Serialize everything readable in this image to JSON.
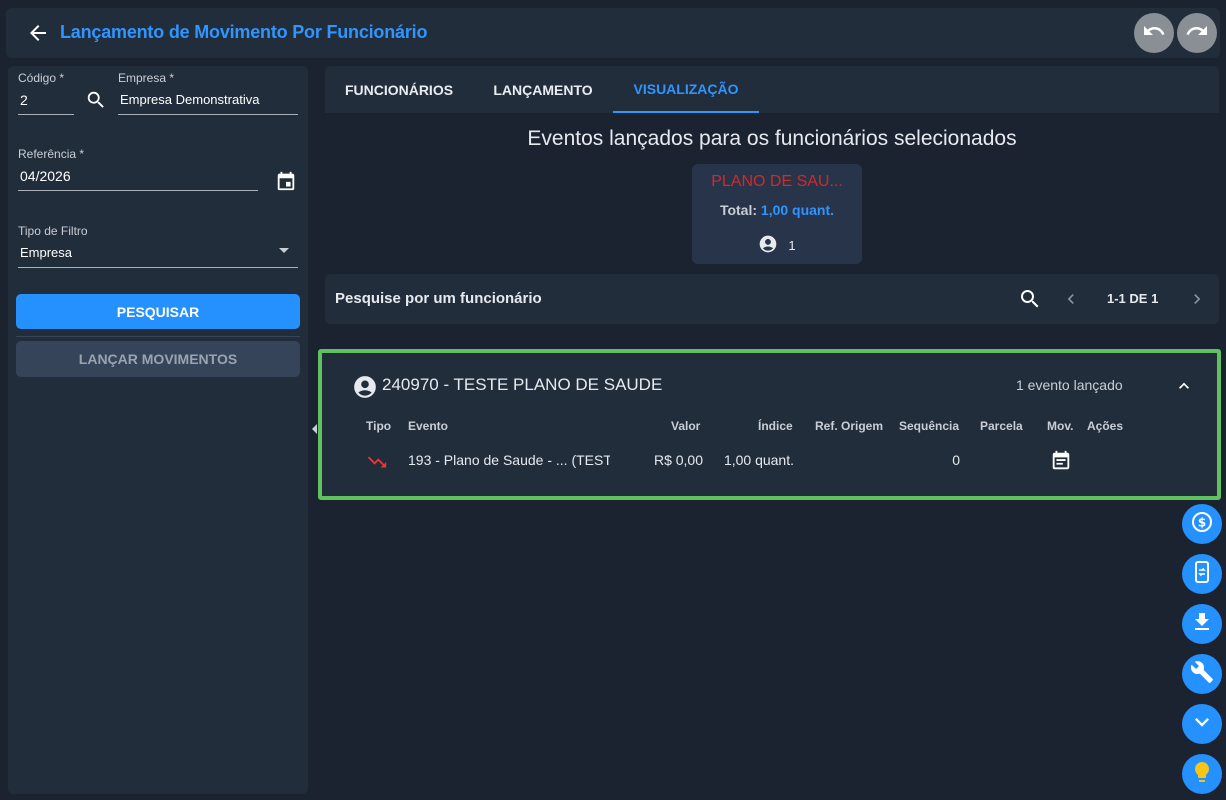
{
  "header": {
    "title": "Lançamento de Movimento Por Funcionário",
    "back_icon": "arrow-left-icon",
    "undo_icon": "undo-icon",
    "redo_icon": "redo-icon"
  },
  "form": {
    "codigo": {
      "label": "Código *",
      "value": "2"
    },
    "empresa": {
      "label": "Empresa *",
      "value": "Empresa Demonstrativa"
    },
    "referencia": {
      "label": "Referência *",
      "value": "04/2026"
    },
    "tipo_filtro": {
      "label": "Tipo de Filtro",
      "value": "Empresa"
    },
    "search_button": "PESQUISAR",
    "launch_button": "LANÇAR MOVIMENTOS"
  },
  "tabs": [
    {
      "label": "FUNCIONÁRIOS",
      "active": false
    },
    {
      "label": "LANÇAMENTO",
      "active": false
    },
    {
      "label": "VISUALIZAÇÃO",
      "active": true
    }
  ],
  "summary": {
    "title": "Eventos lançados para os funcionários selecionados",
    "event_card": {
      "name": "PLANO DE SAU...",
      "total_label": "Total:",
      "total_value": "1,00 quant.",
      "employee_count": "1"
    }
  },
  "employee_search": {
    "label": "Pesquise por um funcionário",
    "pager": "1-1 DE 1"
  },
  "employee": {
    "name": "240970 - TESTE PLANO DE SAUDE",
    "event_count": "1 evento lançado",
    "columns": {
      "tipo": "Tipo",
      "evento": "Evento",
      "valor": "Valor",
      "indice": "Índice",
      "ref_origem": "Ref. Origem",
      "sequencia": "Sequência",
      "parcela": "Parcela",
      "mov": "Mov.",
      "acoes": "Ações"
    },
    "rows": [
      {
        "evento": "193 - Plano de Saude - ... (TESTE",
        "valor": "R$ 0,00",
        "indice": "1,00 quant.",
        "ref_origem": "",
        "sequencia": "0",
        "parcela": ""
      }
    ]
  },
  "colors": {
    "accent": "#2f95ff",
    "event_red": "#d12a2a",
    "highlight_green": "#5fc25f"
  }
}
